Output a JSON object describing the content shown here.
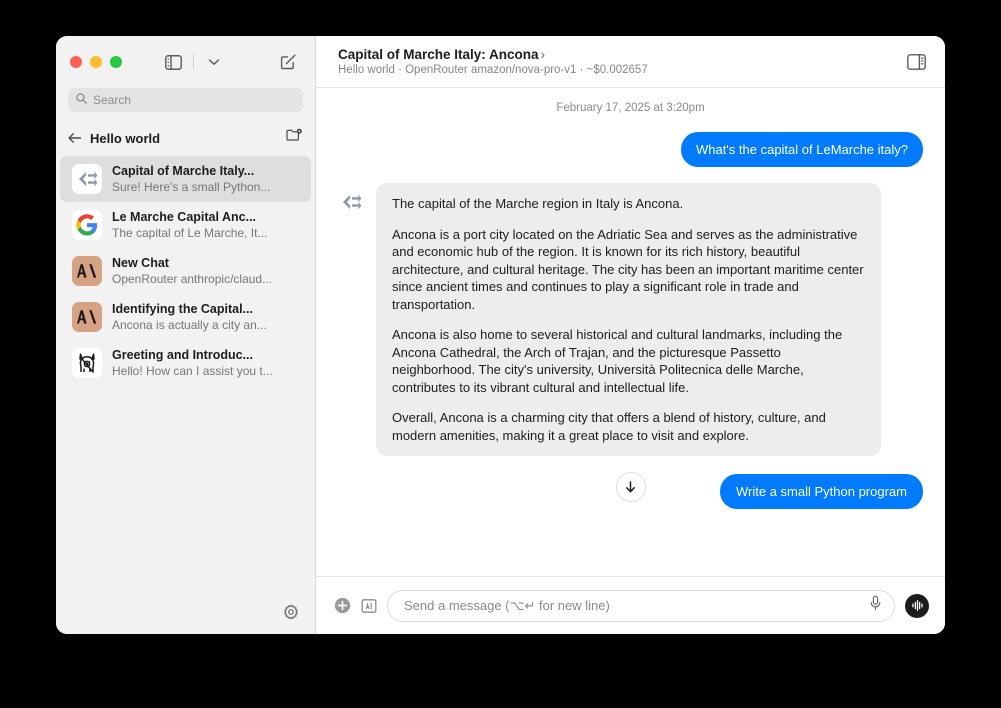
{
  "window": {
    "traffic_lights": [
      "close",
      "minimize",
      "zoom"
    ]
  },
  "sidebar": {
    "toolbar": {
      "sidebar_toggle_icon": "sidebar-toggle-icon",
      "chevron_icon": "chevron-down-icon",
      "compose_icon": "compose-icon"
    },
    "search": {
      "placeholder": "Search",
      "icon": "search-icon"
    },
    "folder": {
      "back_icon": "back-arrow-icon",
      "name": "Hello world",
      "folder_settings_icon": "folder-gear-icon"
    },
    "items": [
      {
        "title": "Capital of Marche Italy...",
        "subtitle": "Sure! Here's a small Python...",
        "icon": "nova-icon",
        "selected": true
      },
      {
        "title": "Le Marche Capital Anc...",
        "subtitle": "The capital of Le Marche, It...",
        "icon": "google-icon",
        "selected": false
      },
      {
        "title": "New Chat",
        "subtitle": "OpenRouter anthropic/claud...",
        "icon": "anthropic-icon",
        "selected": false
      },
      {
        "title": "Identifying the Capital...",
        "subtitle": "Ancona is actually a city an...",
        "icon": "anthropic-icon",
        "selected": false
      },
      {
        "title": "Greeting and Introduc...",
        "subtitle": "Hello! How can I assist you t...",
        "icon": "llama-icon",
        "selected": false
      }
    ],
    "footer": {
      "settings_icon": "gear-icon"
    }
  },
  "header": {
    "title": "Capital of Marche Italy: Ancona",
    "chevron": "›",
    "subtitle": "Hello world · OpenRouter amazon/nova-pro-v1 · ~$0.002657",
    "inspector_icon": "inspector-panel-icon"
  },
  "thread": {
    "timestamp": "February 17, 2025 at 3:20pm",
    "user_message": "What's the capital of LeMarche italy?",
    "assistant_avatar_icon": "nova-icon",
    "assistant_paragraphs": [
      "The capital of the Marche region in Italy is Ancona.",
      "Ancona is a port city located on the Adriatic Sea and serves as the administrative and economic hub of the region. It is known for its rich history, beautiful architecture, and cultural heritage. The city has been an important maritime center since ancient times and continues to play a significant role in trade and transportation.",
      "Ancona is also home to several historical and cultural landmarks, including the Ancona Cathedral, the Arch of Trajan, and the picturesque Passetto neighborhood. The city's university, Università Politecnica delle Marche, contributes to its vibrant cultural and intellectual life.",
      "Overall, Ancona is a charming city that offers a blend of history, culture, and modern amenities, making it a great place to visit and explore."
    ],
    "scroll_button_icon": "scroll-down-icon",
    "suggestion": "Write a small Python program"
  },
  "composer": {
    "add_icon": "plus-circle-icon",
    "attach_icon": "text-image-icon",
    "placeholder": "Send a message (⌥↵ for new line)",
    "mic_icon": "microphone-icon",
    "voice_icon": "waveform-icon"
  },
  "colors": {
    "accent_blue": "#007aff",
    "sidebar_bg": "#f2f2f2",
    "selected_row": "#dedede",
    "assistant_bubble": "#ededed"
  }
}
